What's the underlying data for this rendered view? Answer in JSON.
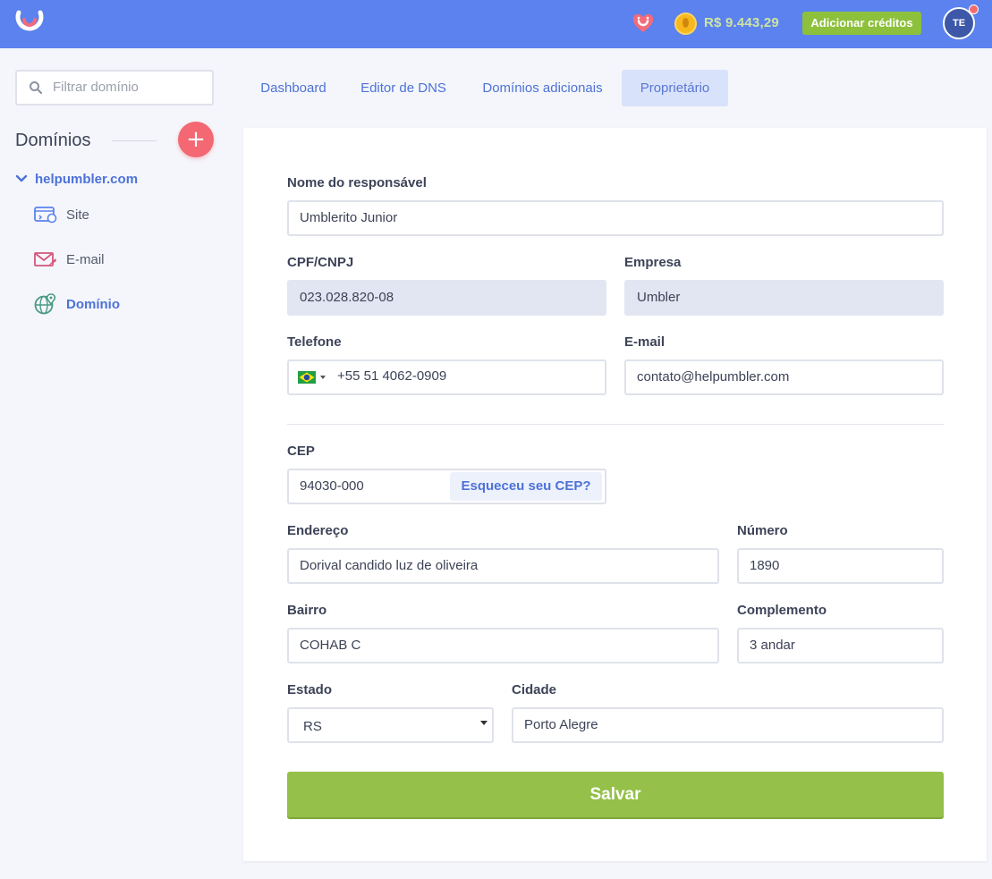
{
  "header": {
    "balance": "R$ 9.443,29",
    "add_credits_label": "Adicionar créditos",
    "avatar_initials": "TE",
    "icons": {
      "logo": "umbler-logo-icon",
      "gift": "gift-heart-icon",
      "coin": "coin-icon"
    },
    "colors": {
      "bar": "#5b82ee",
      "credits_button": "#8dc03c"
    }
  },
  "sidebar": {
    "filter_placeholder": "Filtrar domínio",
    "title": "Domínios",
    "domain": "helpumbler.com",
    "items": [
      {
        "label": "Site",
        "icon": "site-icon",
        "active": false
      },
      {
        "label": "E-mail",
        "icon": "email-icon",
        "active": false
      },
      {
        "label": "Domínio",
        "icon": "domain-globe-icon",
        "active": true
      }
    ]
  },
  "tabs": [
    {
      "label": "Dashboard",
      "active": false
    },
    {
      "label": "Editor de DNS",
      "active": false
    },
    {
      "label": "Domínios adicionais",
      "active": false
    },
    {
      "label": "Proprietário",
      "active": true
    }
  ],
  "form": {
    "owner_name": {
      "label": "Nome do responsável",
      "value": "Umblerito Junior"
    },
    "cpf": {
      "label": "CPF/CNPJ",
      "value": "023.028.820-08"
    },
    "company": {
      "label": "Empresa",
      "value": "Umbler"
    },
    "phone": {
      "label": "Telefone",
      "value": "+55 51 4062-0909",
      "country": "brazil-flag-icon"
    },
    "email": {
      "label": "E-mail",
      "value": "contato@helpumbler.com"
    },
    "cep": {
      "label": "CEP",
      "value": "94030-000",
      "forgot_label": "Esqueceu seu CEP?"
    },
    "address": {
      "label": "Endereço",
      "value": "Dorival candido luz de oliveira"
    },
    "number": {
      "label": "Número",
      "value": "1890"
    },
    "district": {
      "label": "Bairro",
      "value": "COHAB C"
    },
    "complement": {
      "label": "Complemento",
      "value": "3 andar"
    },
    "state": {
      "label": "Estado",
      "value": "RS"
    },
    "city": {
      "label": "Cidade",
      "value": "Porto Alegre"
    },
    "save_label": "Salvar",
    "save_color": "#95c049"
  }
}
